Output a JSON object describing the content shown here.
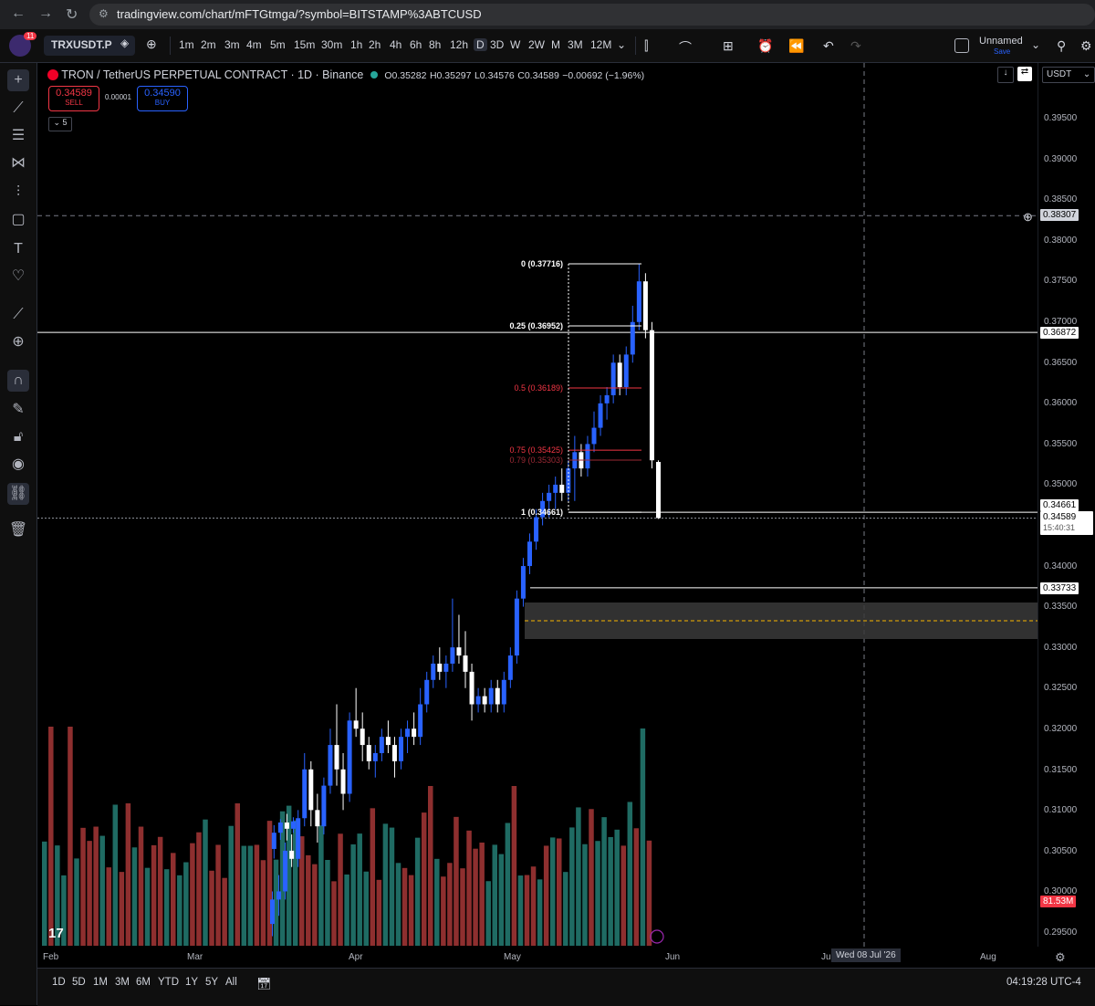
{
  "browser": {
    "url": "tradingview.com/chart/mFTGtmga/?symbol=BITSTAMP%3ABTCUSD",
    "badge": "11"
  },
  "toolbar": {
    "symbol": "TRXUSDT.P",
    "intervals": [
      "1m",
      "2m",
      "3m",
      "4m",
      "5m",
      "15m",
      "30m",
      "1h",
      "2h",
      "4h",
      "6h",
      "8h",
      "12h",
      "D",
      "3D",
      "W",
      "2W",
      "M",
      "3M",
      "12M"
    ],
    "active_interval": "D",
    "layout_name": "Unnamed",
    "save_label": "Save"
  },
  "legend": {
    "title": "TRON / TetherUS PERPETUAL CONTRACT · 1D · Binance",
    "open": "O0.35282",
    "high": "H0.35297",
    "low": "L0.34576",
    "close": "C0.34589",
    "change": "−0.00692 (−1.96%)",
    "sell_price": "0.34589",
    "sell_label": "SELL",
    "spread": "0.00001",
    "buy_price": "0.34590",
    "buy_label": "BUY",
    "indicators_count": "5"
  },
  "price_axis": {
    "currency": "USDT",
    "ticks": [
      "0.39500",
      "0.39000",
      "0.38500",
      "0.38000",
      "0.37500",
      "0.37000",
      "0.36500",
      "0.36000",
      "0.35500",
      "0.35000",
      "0.34500",
      "0.34000",
      "0.33500",
      "0.33000",
      "0.32500",
      "0.32000",
      "0.31500",
      "0.31000",
      "0.30500",
      "0.30000",
      "0.29500"
    ],
    "crosshair_price": "0.38307",
    "level_1": "0.36872",
    "level_2": "0.34661",
    "last_price": "0.34589",
    "countdown": "15:40:31",
    "level_3": "0.33733",
    "volume": "81.53M"
  },
  "fib": {
    "levels": [
      {
        "label": "0 (0.37716)",
        "color": "#ffffff"
      },
      {
        "label": "0.25 (0.36952)",
        "color": "#ffffff"
      },
      {
        "label": "0.5 (0.36189)",
        "color": "#f23645"
      },
      {
        "label": "0.75 (0.35425)",
        "color": "#f23645"
      },
      {
        "label": "0.79 (0.35303)",
        "color": "#9c2a35"
      },
      {
        "label": "1 (0.34661)",
        "color": "#ffffff"
      }
    ]
  },
  "time_axis": {
    "labels": [
      "Feb",
      "Mar",
      "Apr",
      "May",
      "Jun",
      "Ju",
      "Aug"
    ],
    "crosshair_date": "Wed 08 Jul '26"
  },
  "bottom": {
    "ranges": [
      "1D",
      "5D",
      "1M",
      "3M",
      "6M",
      "YTD",
      "1Y",
      "5Y",
      "All"
    ],
    "clock": "04:19:28 UTC-4"
  },
  "chart_data": {
    "type": "candlestick",
    "title": "TRON / TetherUS PERPETUAL CONTRACT · 1D · Binance",
    "x_range": [
      "Feb",
      "Jun"
    ],
    "ylim": [
      0.2935,
      0.3995
    ],
    "series": [
      {
        "name": "TRXUSDT.P",
        "values": [
          [
            0.296,
            0.3,
            0.2945,
            0.299,
            "up"
          ],
          [
            0.299,
            0.302,
            0.297,
            0.3,
            "up"
          ],
          [
            0.3,
            0.306,
            0.299,
            0.305,
            "up"
          ],
          [
            0.305,
            0.307,
            0.303,
            0.304,
            "dn"
          ],
          [
            0.304,
            0.31,
            0.303,
            0.309,
            "up"
          ],
          [
            0.309,
            0.317,
            0.308,
            0.315,
            "up"
          ],
          [
            0.315,
            0.316,
            0.308,
            0.31,
            "dn"
          ],
          [
            0.31,
            0.312,
            0.306,
            0.308,
            "dn"
          ],
          [
            0.308,
            0.314,
            0.307,
            0.313,
            "up"
          ],
          [
            0.313,
            0.32,
            0.312,
            0.318,
            "up"
          ],
          [
            0.318,
            0.323,
            0.313,
            0.315,
            "dn"
          ],
          [
            0.315,
            0.317,
            0.31,
            0.312,
            "dn"
          ],
          [
            0.312,
            0.322,
            0.311,
            0.321,
            "up"
          ],
          [
            0.321,
            0.325,
            0.319,
            0.32,
            "dn"
          ],
          [
            0.32,
            0.322,
            0.316,
            0.318,
            "dn"
          ],
          [
            0.318,
            0.319,
            0.315,
            0.316,
            "dn"
          ],
          [
            0.316,
            0.318,
            0.314,
            0.317,
            "up"
          ],
          [
            0.317,
            0.32,
            0.316,
            0.319,
            "up"
          ],
          [
            0.319,
            0.321,
            0.317,
            0.318,
            "dn"
          ],
          [
            0.318,
            0.319,
            0.314,
            0.316,
            "dn"
          ],
          [
            0.316,
            0.32,
            0.315,
            0.319,
            "up"
          ],
          [
            0.319,
            0.321,
            0.317,
            0.32,
            "up"
          ],
          [
            0.32,
            0.322,
            0.318,
            0.319,
            "dn"
          ],
          [
            0.319,
            0.325,
            0.318,
            0.323,
            "up"
          ],
          [
            0.323,
            0.327,
            0.322,
            0.326,
            "up"
          ],
          [
            0.326,
            0.329,
            0.325,
            0.328,
            "up"
          ],
          [
            0.328,
            0.33,
            0.326,
            0.327,
            "dn"
          ],
          [
            0.327,
            0.329,
            0.325,
            0.328,
            "up"
          ],
          [
            0.328,
            0.336,
            0.327,
            0.33,
            "up"
          ],
          [
            0.33,
            0.334,
            0.328,
            0.329,
            "dn"
          ],
          [
            0.329,
            0.332,
            0.325,
            0.327,
            "dn"
          ],
          [
            0.327,
            0.328,
            0.321,
            0.323,
            "dn"
          ],
          [
            0.323,
            0.325,
            0.322,
            0.324,
            "up"
          ],
          [
            0.324,
            0.325,
            0.322,
            0.323,
            "dn"
          ],
          [
            0.323,
            0.326,
            0.322,
            0.325,
            "up"
          ],
          [
            0.325,
            0.326,
            0.322,
            0.323,
            "dn"
          ],
          [
            0.323,
            0.327,
            0.322,
            0.326,
            "up"
          ],
          [
            0.326,
            0.33,
            0.325,
            0.329,
            "up"
          ],
          [
            0.329,
            0.337,
            0.328,
            0.336,
            "up"
          ],
          [
            0.336,
            0.341,
            0.335,
            0.34,
            "up"
          ],
          [
            0.34,
            0.344,
            0.339,
            0.343,
            "up"
          ],
          [
            0.343,
            0.347,
            0.342,
            0.346,
            "up"
          ],
          [
            0.346,
            0.349,
            0.345,
            0.348,
            "up"
          ],
          [
            0.348,
            0.35,
            0.346,
            0.349,
            "up"
          ],
          [
            0.349,
            0.351,
            0.347,
            0.35,
            "up"
          ],
          [
            0.35,
            0.352,
            0.348,
            0.349,
            "dn"
          ],
          [
            0.349,
            0.353,
            0.348,
            0.352,
            "up"
          ],
          [
            0.352,
            0.356,
            0.348,
            0.354,
            "up"
          ],
          [
            0.354,
            0.355,
            0.351,
            0.352,
            "dn"
          ],
          [
            0.352,
            0.356,
            0.351,
            0.355,
            "up"
          ],
          [
            0.355,
            0.359,
            0.354,
            0.357,
            "up"
          ],
          [
            0.357,
            0.361,
            0.356,
            0.36,
            "up"
          ],
          [
            0.36,
            0.362,
            0.358,
            0.361,
            "up"
          ],
          [
            0.361,
            0.366,
            0.36,
            0.365,
            "up"
          ],
          [
            0.365,
            0.366,
            0.361,
            0.362,
            "dn"
          ],
          [
            0.362,
            0.367,
            0.361,
            0.366,
            "up"
          ],
          [
            0.366,
            0.372,
            0.365,
            0.37,
            "up"
          ],
          [
            0.37,
            0.3772,
            0.369,
            0.375,
            "up"
          ],
          [
            0.375,
            0.376,
            0.368,
            0.369,
            "dn"
          ],
          [
            0.369,
            0.37,
            0.352,
            0.353,
            "dn"
          ],
          [
            0.3528,
            0.353,
            0.3458,
            0.3459,
            "dn"
          ]
        ]
      }
    ]
  },
  "colors": {
    "up": "#2962ff",
    "down": "#ffffff",
    "vol_up": "#26a69a",
    "vol_down": "#ef5350",
    "accent": "#2962ff"
  }
}
